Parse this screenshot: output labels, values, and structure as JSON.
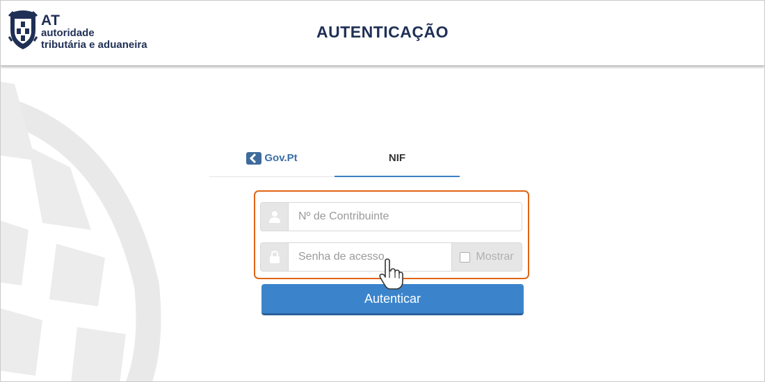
{
  "header": {
    "logo": {
      "abbr": "AT",
      "line1": "autoridade",
      "line2": "tributária e aduaneira"
    },
    "title": "AUTENTICAÇÃO"
  },
  "tabs": [
    {
      "label": "Gov.Pt",
      "icon": "gov-pt-icon",
      "active": false
    },
    {
      "label": "NIF",
      "active": true
    }
  ],
  "form": {
    "nif": {
      "placeholder": "Nº de Contribuinte",
      "value": "",
      "icon": "user-icon"
    },
    "password": {
      "placeholder": "Senha de acesso",
      "value": "",
      "icon": "lock-icon"
    },
    "show_label": "Mostrar",
    "submit_label": "Autenticar"
  },
  "colors": {
    "primary": "#3b84cc",
    "highlight": "#e06414",
    "brand_text": "#1f2f55",
    "tab_active": "#3b7fc4"
  }
}
